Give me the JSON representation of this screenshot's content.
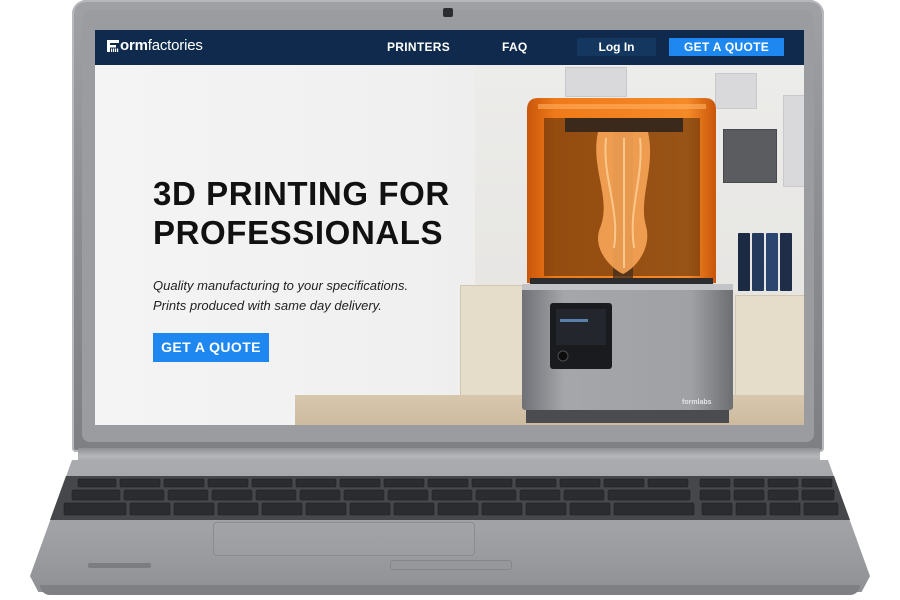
{
  "site": {
    "logo_bold": "orm",
    "logo_light": "factories",
    "logo_icon": "formfactories-f-mark"
  },
  "nav": {
    "printers": "PRINTERS",
    "faq": "FAQ",
    "login": "Log In",
    "quote": "GET A QUOTE"
  },
  "hero": {
    "title": "3D PRINTING FOR PROFESSIONALS",
    "subtitle_line1": "Quality manufacturing to your specifications.",
    "subtitle_line2": "Prints produced with same day delivery.",
    "cta": "GET A QUOTE"
  },
  "printer": {
    "brand_mark": "formlabs"
  },
  "colors": {
    "navbar": "#0f2a4d",
    "login_button": "#14375f",
    "accent_blue": "#1e88f0",
    "printer_orange": "#f07a1a",
    "laptop_gray": "#9a9c9f"
  }
}
